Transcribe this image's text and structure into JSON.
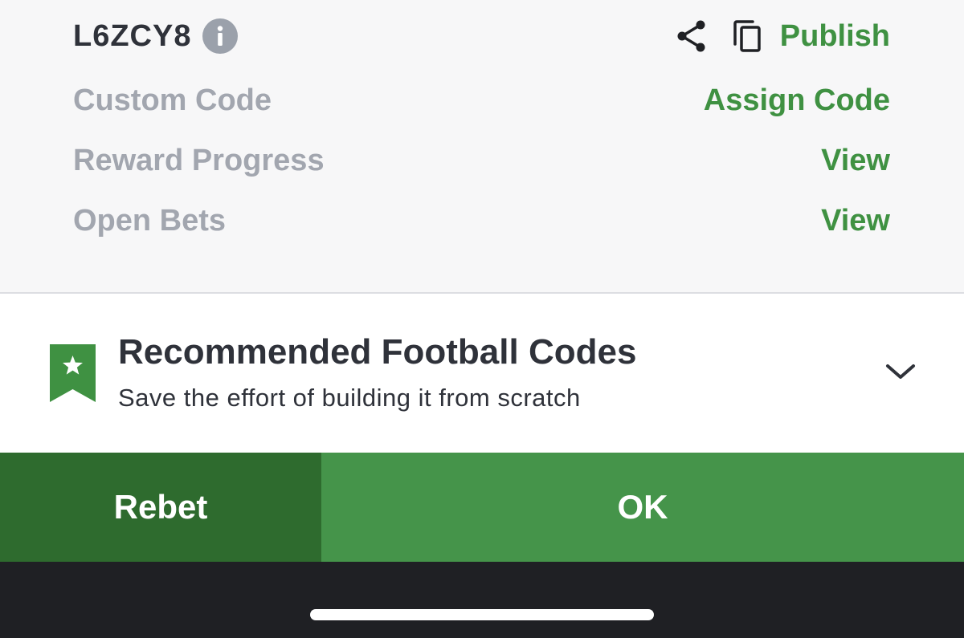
{
  "booking": {
    "code": "L6ZCY8",
    "publish_label": "Publish"
  },
  "details": [
    {
      "label": "Custom Code",
      "action": "Assign Code"
    },
    {
      "label": "Reward Progress",
      "action": "View"
    },
    {
      "label": "Open Bets",
      "action": "View"
    }
  ],
  "recommended": {
    "title": "Recommended Football Codes",
    "subtitle": "Save the effort of building it from scratch"
  },
  "buttons": {
    "rebet": "Rebet",
    "ok": "OK"
  },
  "icons": {
    "info": "info-icon",
    "share": "share-icon",
    "copy": "copy-icon",
    "bookmark": "bookmark-star-icon",
    "chevron": "chevron-down-icon"
  },
  "colors": {
    "accent_green": "#3f9142",
    "dark_green": "#2e6b2e",
    "ok_green": "#45944a",
    "muted_gray": "#a2a6af",
    "text_dark": "#2f323a"
  }
}
